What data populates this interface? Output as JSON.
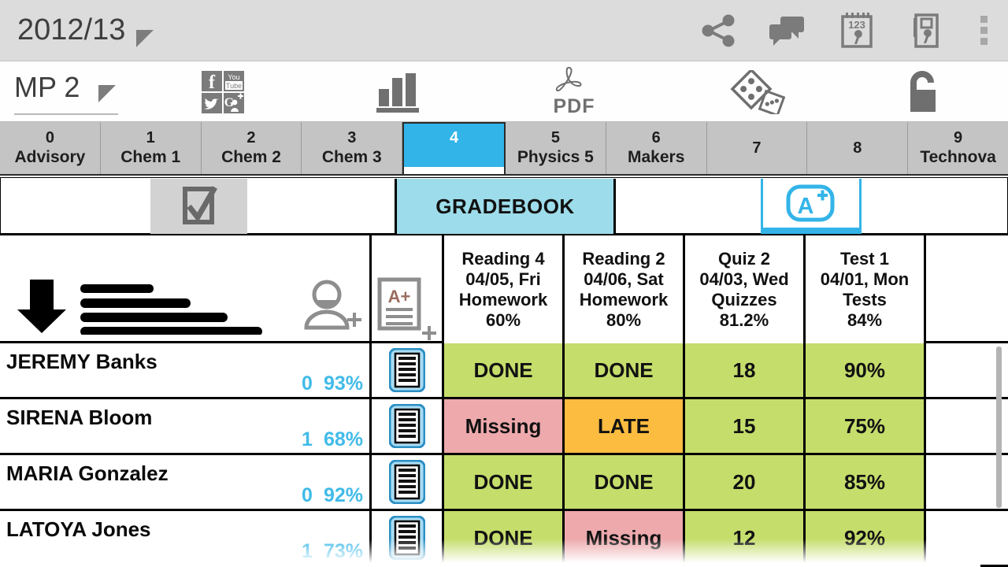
{
  "header": {
    "year_label": "2012/13",
    "year_dropdown_icon": "triangle-down-icon",
    "icons": [
      {
        "name": "share-icon",
        "label": "Share"
      },
      {
        "name": "messages-icon",
        "label": "Messages"
      },
      {
        "name": "calendar-settings-icon",
        "label": "Calendar Settings"
      },
      {
        "name": "device-settings-icon",
        "label": "Device Settings"
      },
      {
        "name": "overflow-menu-icon",
        "label": "More options"
      }
    ]
  },
  "mp_bar": {
    "mp_label": "MP 2",
    "mp_dropdown_icon": "triangle-down-icon",
    "social_icons": [
      {
        "name": "facebook-icon",
        "label": "f"
      },
      {
        "name": "youtube-icon",
        "label": "You Tube"
      },
      {
        "name": "twitter-icon",
        "label": "Twitter"
      },
      {
        "name": "googleplus-icon",
        "label": "G+"
      }
    ],
    "chart_icon": "bar-chart-icon",
    "pdf_icon": "pdf-icon",
    "pdf_label": "PDF",
    "dice_icon": "dice-icon",
    "lock_icon": "unlocked-padlock-icon"
  },
  "class_tabs": [
    {
      "num": "0",
      "name": "Advisory",
      "selected": false
    },
    {
      "num": "1",
      "name": "Chem 1",
      "selected": false
    },
    {
      "num": "2",
      "name": "Chem 2",
      "selected": false
    },
    {
      "num": "3",
      "name": "Chem 3",
      "selected": false
    },
    {
      "num": "4",
      "name": "",
      "selected": true
    },
    {
      "num": "5",
      "name": "Physics 5",
      "selected": false
    },
    {
      "num": "6",
      "name": "Makers",
      "selected": false
    },
    {
      "num": "7",
      "name": "",
      "selected": false
    },
    {
      "num": "8",
      "name": "",
      "selected": false
    },
    {
      "num": "9",
      "name": "Technova",
      "selected": false
    }
  ],
  "section_tabs": {
    "attendance_icon": "checkbox-checked-icon",
    "gradebook_label": "GRADEBOOK",
    "grades_icon": "a-plus-icon"
  },
  "table": {
    "name_column_icons": {
      "sort_icon": "down-arrow-icon",
      "list_icon": "roster-lines-icon",
      "add_student_icon": "add-person-icon"
    },
    "doc_column_icon": "add-assignment-icon",
    "assignments": [
      {
        "title": "Reading 4",
        "date": "04/05, Fri",
        "category": "Homework",
        "average": "60%"
      },
      {
        "title": "Reading 2",
        "date": "04/06, Sat",
        "category": "Homework",
        "average": "80%"
      },
      {
        "title": "Quiz 2",
        "date": "04/03, Wed",
        "category": "Quizzes",
        "average": "81.2%"
      },
      {
        "title": "Test 1",
        "date": "04/01, Mon",
        "category": "Tests",
        "average": "84%"
      }
    ],
    "students": [
      {
        "name": "JEREMY  Banks",
        "missing": "0",
        "average": "93%",
        "doc_icon": "student-report-icon",
        "grades": [
          {
            "value": "DONE",
            "status": "ok"
          },
          {
            "value": "DONE",
            "status": "ok"
          },
          {
            "value": "18",
            "status": "ok"
          },
          {
            "value": "90%",
            "status": "ok"
          }
        ]
      },
      {
        "name": "SIRENA  Bloom",
        "missing": "1",
        "average": "68%",
        "doc_icon": "student-report-icon",
        "grades": [
          {
            "value": "Missing",
            "status": "missing"
          },
          {
            "value": "LATE",
            "status": "late"
          },
          {
            "value": "15",
            "status": "ok"
          },
          {
            "value": "75%",
            "status": "ok"
          }
        ]
      },
      {
        "name": "MARIA  Gonzalez",
        "missing": "0",
        "average": "92%",
        "doc_icon": "student-report-icon",
        "grades": [
          {
            "value": "DONE",
            "status": "ok"
          },
          {
            "value": "DONE",
            "status": "ok"
          },
          {
            "value": "20",
            "status": "ok"
          },
          {
            "value": "85%",
            "status": "ok"
          }
        ]
      },
      {
        "name": "LATOYA  Jones",
        "missing": "1",
        "average": "73%",
        "doc_icon": "student-report-icon",
        "grades": [
          {
            "value": "DONE",
            "status": "ok"
          },
          {
            "value": "Missing",
            "status": "missing"
          },
          {
            "value": "12",
            "status": "ok"
          },
          {
            "value": "92%",
            "status": "ok"
          }
        ]
      }
    ]
  },
  "colors": {
    "accent_blue": "#33b4e8",
    "gradebook_tab": "#9ddcea",
    "grade_ok": "#c5dd6b",
    "grade_missing": "#eda9ac",
    "grade_late": "#fcbc40",
    "stat_text": "#41bbe8",
    "chrome_gray": "#dcdcdc",
    "tabstrip_gray": "#c4c4c4"
  }
}
